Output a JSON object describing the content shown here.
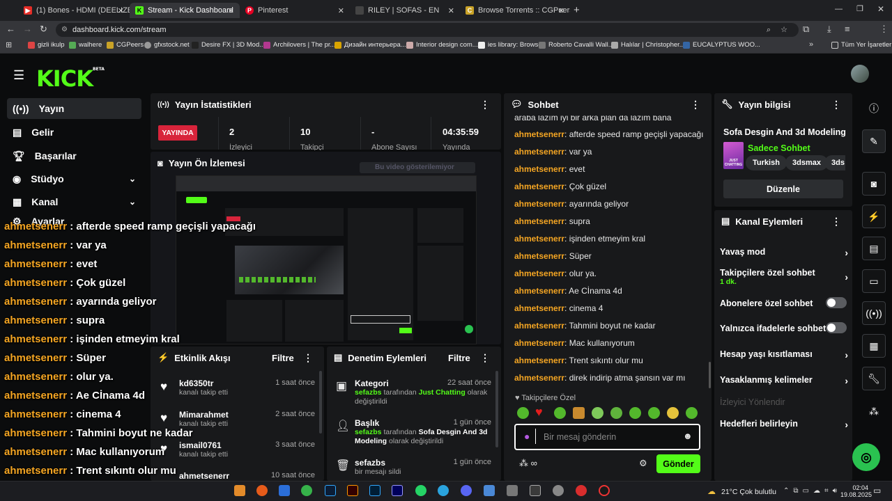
{
  "browser": {
    "tabs": [
      {
        "label": "(1) Bones - HDMI (DEELIZE",
        "icon": "youtube-icon",
        "color": "#e52d27"
      },
      {
        "label": "Stream - Kick Dashboard",
        "icon": "kick-icon",
        "color": "#53fc18"
      },
      {
        "label": "Pinterest",
        "icon": "pinterest-icon",
        "color": "#e60023"
      },
      {
        "label": "RILEY | SOFAS - EN",
        "icon": "riley-icon",
        "color": "#444"
      },
      {
        "label": "Browse Torrents :: CGPeers",
        "icon": "cgpeers-icon",
        "color": "#c9a227"
      }
    ],
    "url": "dashboard.kick.com/stream",
    "bookmarks": [
      "gizli ikulp",
      "walhere",
      "CGPeers",
      "gfxstock.net",
      "Desire FX | 3D Mod...",
      "Archilovers | The pr...",
      "Дизайн интерьера...",
      "Interior design com...",
      "ies library: Browse",
      "Roberto Cavalli Wall...",
      "Halılar | Christopher...",
      "EUCALYPTUS WOO..."
    ],
    "all_bookmarks": "Tüm Yer İşaretleri"
  },
  "brand": {
    "logo": "KICK",
    "beta": "BETA",
    "accent": "#53fc18"
  },
  "sidebar": {
    "items": [
      {
        "label": "Yayın",
        "icon": "broadcast-icon"
      },
      {
        "label": "Gelir",
        "icon": "revenue-icon"
      },
      {
        "label": "Başarılar",
        "icon": "trophy-icon"
      },
      {
        "label": "Stüdyo",
        "icon": "studio-icon"
      },
      {
        "label": "Kanal",
        "icon": "channel-icon"
      },
      {
        "label": "Ayarlar",
        "icon": "settings-icon"
      }
    ]
  },
  "stats": {
    "title": "Yayın İstatistikleri",
    "live": "YAYINDA",
    "values": [
      {
        "value": "2",
        "label": "İzleyici"
      },
      {
        "value": "10",
        "label": "Takipçi"
      },
      {
        "value": "-",
        "label": "Abone Sayısı"
      },
      {
        "value": "04:35:59",
        "label": "Yayında"
      }
    ]
  },
  "preview": {
    "title": "Yayın Ön İzlemesi",
    "hint": "Bu video gösterilemiyor"
  },
  "overlay_chat": [
    {
      "user": "ahmetsenerr",
      "msg": "afterde speed ramp geçişli yapacağı"
    },
    {
      "user": "ahmetsenerr",
      "msg": "var ya"
    },
    {
      "user": "ahmetsenerr",
      "msg": "evet"
    },
    {
      "user": "ahmetsenerr",
      "msg": "Çok güzel"
    },
    {
      "user": "ahmetsenerr",
      "msg": "ayarında geliyor"
    },
    {
      "user": "ahmetsenerr",
      "msg": "supra"
    },
    {
      "user": "ahmetsenerr",
      "msg": "işinden etmeyim kral"
    },
    {
      "user": "ahmetsenerr",
      "msg": "Süper"
    },
    {
      "user": "ahmetsenerr",
      "msg": "olur ya."
    },
    {
      "user": "ahmetsenerr",
      "msg": "Ae Cİnama 4d"
    },
    {
      "user": "ahmetsenerr",
      "msg": "cinema 4"
    },
    {
      "user": "ahmetsenerr",
      "msg": "Tahmini boyut ne kadar"
    },
    {
      "user": "ahmetsenerr",
      "msg": "Mac kullanıyorum"
    },
    {
      "user": "ahmetsenerr",
      "msg": "Trent sıkıntı olur mu"
    },
    {
      "user": "ahmetsenerr",
      "msg": "direk indirip atma şansın var mı"
    }
  ],
  "activity": {
    "title": "Etkinlik Akışı",
    "filter": "Filtre",
    "items": [
      {
        "user": "kd6350tr",
        "text": "kanalı takip etti",
        "time": "1 saat önce"
      },
      {
        "user": "Mimarahmet",
        "text": "kanalı takip etti",
        "time": "2 saat önce"
      },
      {
        "user": "ismail0761",
        "text": "kanalı takip etti",
        "time": "3 saat önce"
      },
      {
        "user": "ahmetsenerr",
        "text": "",
        "time": "10 saat önce"
      }
    ]
  },
  "moderation": {
    "title": "Denetim Eylemleri",
    "filter": "Filtre",
    "items": [
      {
        "title": "Kategori",
        "time": "22 saat önce",
        "actor": "sefazbs",
        "by": "tarafından",
        "value": "Just Chatting",
        "suffix": "olarak değiştirildi"
      },
      {
        "title": "Başlık",
        "time": "1 gün önce",
        "actor": "sefazbs",
        "by": "tarafından",
        "value": "Sofa Desgin And 3d Modeling",
        "suffix": "olarak değiştirildi"
      },
      {
        "title": "sefazbs",
        "time": "1 gün önce",
        "actor": "",
        "by": "bir mesajı sildi",
        "value": "",
        "suffix": ""
      }
    ]
  },
  "chat": {
    "title": "Sohbet",
    "top_partial": "araba lazım iyi bir arka plan da lazım bana",
    "messages": [
      {
        "user": "ahmetsenerr",
        "msg": "afterde speed ramp geçişli yapacağı"
      },
      {
        "user": "ahmetsenerr",
        "msg": "var ya"
      },
      {
        "user": "ahmetsenerr",
        "msg": "evet"
      },
      {
        "user": "ahmetsenerr",
        "msg": "Çok güzel"
      },
      {
        "user": "ahmetsenerr",
        "msg": "ayarında geliyor"
      },
      {
        "user": "ahmetsenerr",
        "msg": "supra"
      },
      {
        "user": "ahmetsenerr",
        "msg": "işinden etmeyim kral"
      },
      {
        "user": "ahmetsenerr",
        "msg": "Süper"
      },
      {
        "user": "ahmetsenerr",
        "msg": "olur ya."
      },
      {
        "user": "ahmetsenerr",
        "msg": "Ae Cİnama 4d"
      },
      {
        "user": "ahmetsenerr",
        "msg": "cinema 4"
      },
      {
        "user": "ahmetsenerr",
        "msg": "Tahmini boyut ne kadar"
      },
      {
        "user": "ahmetsenerr",
        "msg": "Mac kullanıyorum"
      },
      {
        "user": "ahmetsenerr",
        "msg": "Trent sıkıntı olur mu"
      },
      {
        "user": "ahmetsenerr",
        "msg": "direk indirip atma şansın var mı"
      }
    ],
    "followers_only": "Takipçilere Özel",
    "placeholder": "Bir mesaj gönderin",
    "send": "Gönder"
  },
  "stream_info": {
    "title": "Yayın bilgisi",
    "stream_title": "Sofa Desgin And 3d Modeling",
    "category": "Sadece Sohbet",
    "thumb_label": "JUST CHATTING",
    "tags": [
      "Turkish",
      "3dsmax",
      "3ds"
    ],
    "edit": "Düzenle"
  },
  "channel_actions": {
    "title": "Kanal Eylemleri",
    "slow_mode": "Yavaş mod",
    "followers_chat": "Takipçilere özel sohbet",
    "followers_chat_value": "1 dk.",
    "subs_chat": "Abonelere özel sohbet",
    "emote_chat": "Yalnızca ifadelerle sohbet",
    "account_age": "Hesap yaşı kısıtlaması",
    "banned_words": "Yasaklanmış kelimeler",
    "viewer_redirect": "İzleyici Yönlendir",
    "goals": "Hedefleri belirleyin"
  },
  "taskbar": {
    "weather": "21°C  Çok bulutlu",
    "time": "02:04",
    "date": "19.08.2025"
  }
}
